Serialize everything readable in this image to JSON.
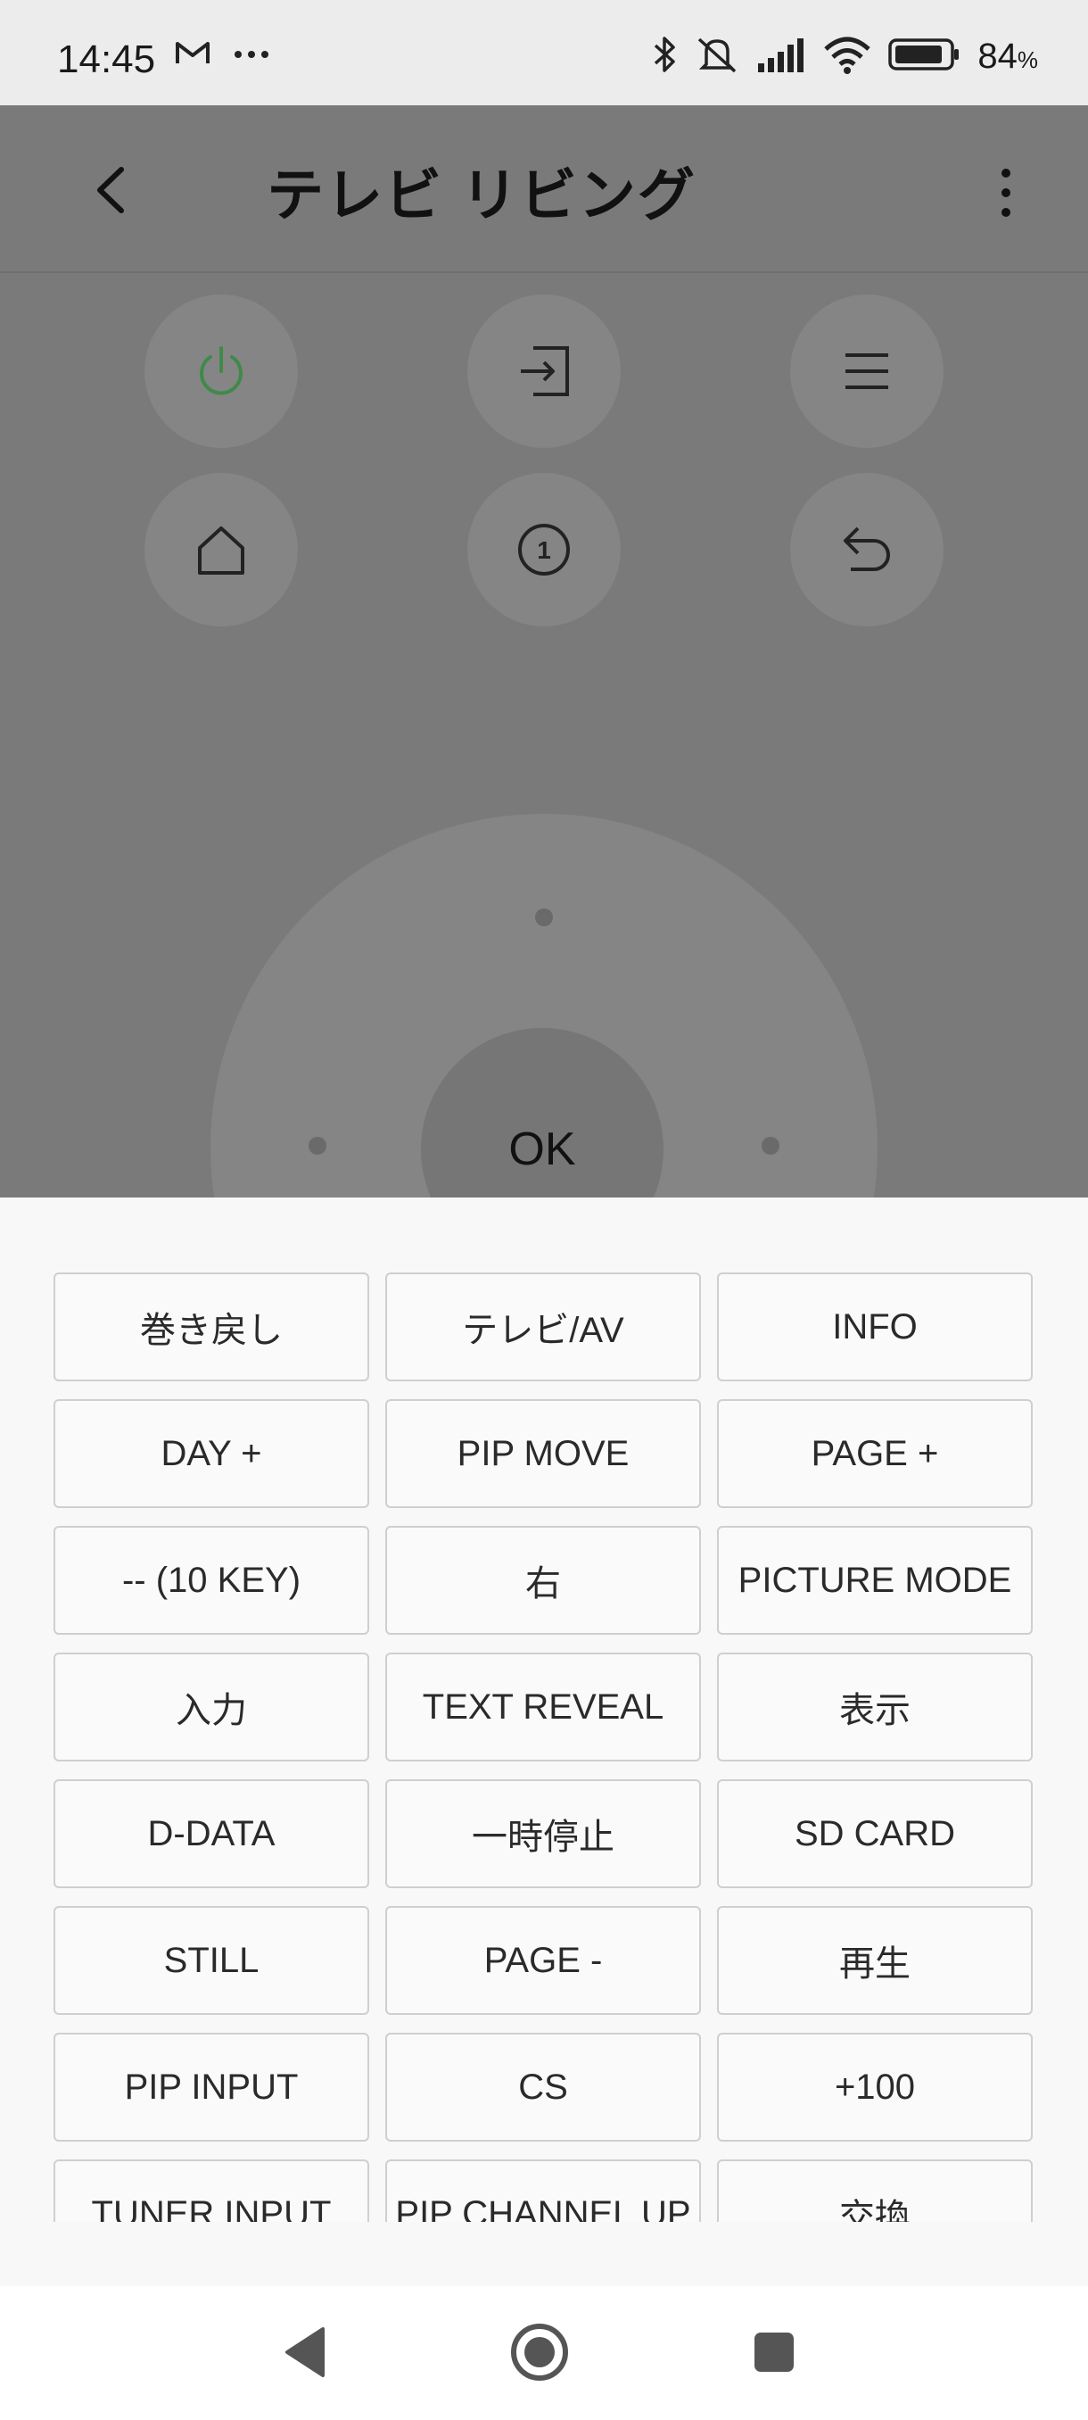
{
  "status_bar": {
    "time": "14:45",
    "left_icons": [
      "gmail-icon",
      "more-notifications-icon"
    ],
    "right_icons": [
      "bluetooth-icon",
      "mute-icon",
      "signal-icon",
      "wifi-icon",
      "battery-icon"
    ],
    "battery_percent": "84",
    "battery_unit": "%"
  },
  "app_bar": {
    "title": "テレビ リビング",
    "back_icon": "chevron-left-icon",
    "menu_icon": "more-vert-icon"
  },
  "remote": {
    "top_buttons": [
      {
        "name": "power",
        "icon": "power-icon",
        "color": "#3f8a4a"
      },
      {
        "name": "input",
        "icon": "input-icon"
      },
      {
        "name": "menu",
        "icon": "hamburger-icon"
      },
      {
        "name": "home",
        "icon": "home-icon"
      },
      {
        "name": "number",
        "icon": "number-one-icon"
      },
      {
        "name": "return",
        "icon": "return-icon"
      }
    ],
    "ok_label": "OK"
  },
  "keys": [
    "巻き戻し",
    "テレビ/AV",
    "INFO",
    "DAY +",
    "PIP MOVE",
    "PAGE +",
    "-- (10 KEY)",
    "右",
    "PICTURE MODE",
    "入力",
    "TEXT REVEAL",
    "表示",
    "D-DATA",
    "一時停止",
    "SD CARD",
    "STILL",
    "PAGE -",
    "再生",
    "PIP INPUT",
    "CS",
    "+100",
    "TUNER  INPUT",
    "PIP CHANNEL UP",
    "交換"
  ],
  "nav_bar": {
    "back_icon": "nav-back-icon",
    "home_icon": "nav-home-icon",
    "recents_icon": "nav-recents-icon"
  },
  "colors": {
    "dim_overlay": "#7a7a7a",
    "button_bg": "#858585",
    "power_accent": "#3f8a4a",
    "sheet_bg": "#f8f8f8",
    "key_border": "#cfcfcf"
  }
}
